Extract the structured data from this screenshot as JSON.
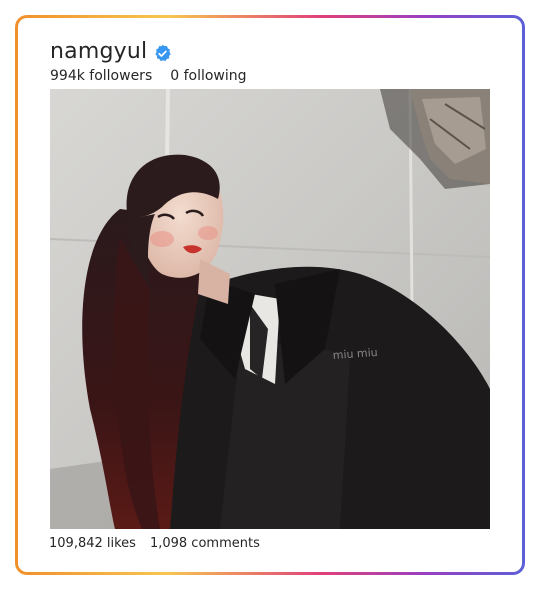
{
  "profile": {
    "username": "namgyul",
    "verified_icon": "verified-badge-icon",
    "followers": "994k followers",
    "following": "0 following"
  },
  "post": {
    "image_icon": "post-photo",
    "likes": "109,842 likes",
    "comments": "1,098 comments"
  },
  "colors": {
    "border_gradient": [
      "#f0902a",
      "#f6c64f",
      "#e0407a",
      "#9a3fc0",
      "#5c5fd8"
    ],
    "verified_blue": "#3897f0",
    "text": "#262626"
  }
}
